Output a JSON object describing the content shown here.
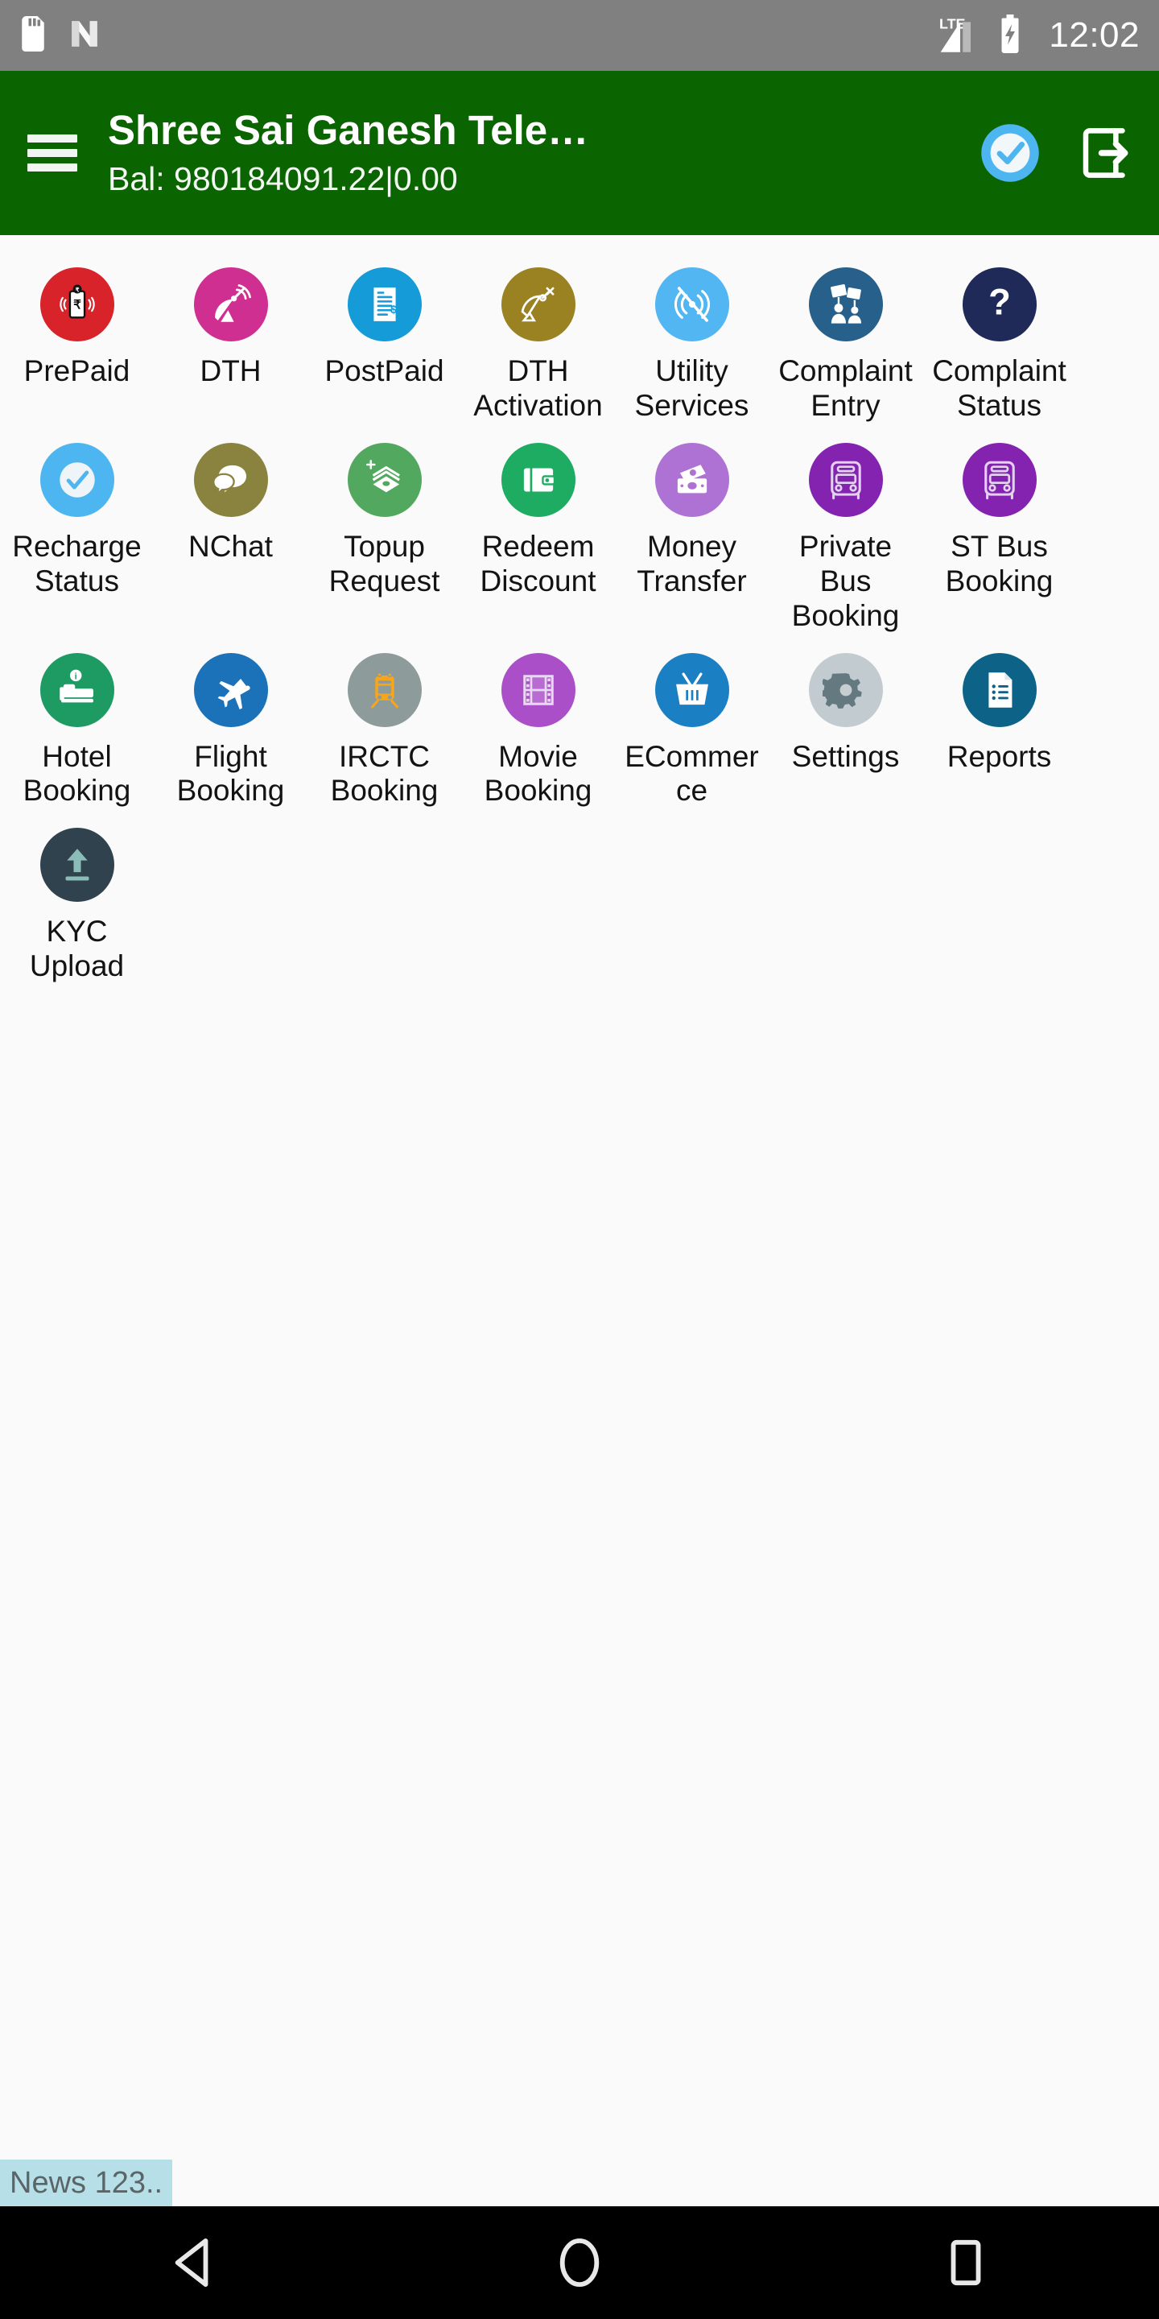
{
  "status_bar": {
    "time": "12:02",
    "icons": [
      "sd-card-icon",
      "android-nougat-icon",
      "lte-signal-icon",
      "battery-charging-icon"
    ],
    "network_label": "LTE",
    "background_color": "#808080"
  },
  "app_bar": {
    "menu_icon": "hamburger-menu-icon",
    "title": "Shree Sai Ganesh Tele…",
    "balance": "Bal: 980184091.22|0.00",
    "background_color": "#0a6400",
    "actions": [
      {
        "name": "recharge-status-icon",
        "label": "Recharge Status",
        "color": "#4db5ef"
      },
      {
        "name": "logout-icon",
        "label": "Logout",
        "color": "#ffffff"
      }
    ]
  },
  "grid": {
    "items": [
      {
        "label": "PrePaid",
        "icon": "prepaid-mobile-icon",
        "color": "#d8232a"
      },
      {
        "label": "DTH",
        "icon": "satellite-dish-icon",
        "color": "#d02f92"
      },
      {
        "label": "PostPaid",
        "icon": "invoice-bill-icon",
        "color": "#159bd7"
      },
      {
        "label": "DTH Activation",
        "icon": "dth-activation-icon",
        "color": "#9a8223"
      },
      {
        "label": "Utility Services",
        "icon": "utility-signal-off-icon",
        "color": "#51b6f2"
      },
      {
        "label": "Complaint Entry",
        "icon": "protest-people-icon",
        "color": "#27618b"
      },
      {
        "label": "Complaint Status",
        "icon": "question-mark-icon",
        "color": "#1f2a58"
      },
      {
        "label": "Recharge Status",
        "icon": "check-circle-icon",
        "color": "#4db5ef"
      },
      {
        "label": "NChat",
        "icon": "chat-bubbles-icon",
        "color": "#8a8340"
      },
      {
        "label": "Topup Request",
        "icon": "money-stack-plus-icon",
        "color": "#52a85e"
      },
      {
        "label": "Redeem Discount",
        "icon": "wallet-icon",
        "color": "#1eab62"
      },
      {
        "label": "Money Transfer",
        "icon": "money-transfer-icon",
        "color": "#ad72d4"
      },
      {
        "label": "Private Bus Booking",
        "icon": "bus-icon",
        "color": "#8323b0"
      },
      {
        "label": "ST Bus Booking",
        "icon": "bus-icon",
        "color": "#8323b0"
      },
      {
        "label": "Hotel Booking",
        "icon": "hotel-bed-icon",
        "color": "#1e9b63"
      },
      {
        "label": "Flight Booking",
        "icon": "airplane-icon",
        "color": "#1b72b8"
      },
      {
        "label": "IRCTC Booking",
        "icon": "train-icon",
        "color": "#8d9b9b"
      },
      {
        "label": "Movie Booking",
        "icon": "film-strip-icon",
        "color": "#ab4fc9"
      },
      {
        "label": "ECommerce",
        "icon": "shopping-basket-icon",
        "color": "#1b7fc4"
      },
      {
        "label": "Settings",
        "icon": "gear-icon",
        "color": "#c2cbcf"
      },
      {
        "label": "Reports",
        "icon": "report-document-icon",
        "color": "#0c6387"
      },
      {
        "label": "KYC Upload",
        "icon": "upload-arrow-icon",
        "color": "#31424f"
      }
    ]
  },
  "news_ticker": {
    "text": "News 123..",
    "background_color": "#b6dfe8"
  },
  "nav_bar": {
    "buttons": [
      {
        "name": "back-button",
        "icon": "triangle-back-icon"
      },
      {
        "name": "home-button",
        "icon": "circle-home-icon"
      },
      {
        "name": "recents-button",
        "icon": "square-recents-icon"
      }
    ],
    "background_color": "#000000"
  }
}
